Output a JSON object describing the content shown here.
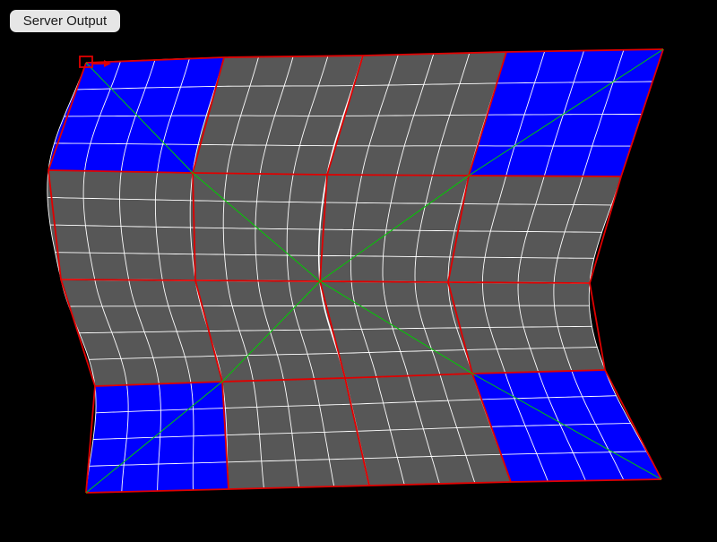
{
  "toolbar": {
    "server_output_label": "Server Output"
  },
  "colors": {
    "background": "#000000",
    "cell_fill": "#575757",
    "corner_fill": "#0000ff",
    "fine_grid": "#ffffff",
    "patch_border": "#e00000",
    "diagonal": "#00cc00",
    "handle": "#e00000"
  },
  "mesh": {
    "patches_per_side": 4,
    "subdivisions_per_patch": 4
  }
}
